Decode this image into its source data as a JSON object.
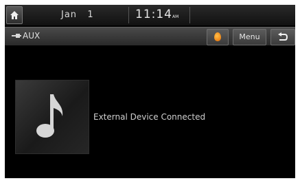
{
  "status_bar": {
    "date": "Jan   1",
    "time": "11:14",
    "ampm": "AM"
  },
  "title_bar": {
    "source": "AUX",
    "menu_label": "Menu"
  },
  "main": {
    "status_text": "External Device Connected"
  },
  "icons": {
    "home": "home-icon",
    "aux": "aux-cable-icon",
    "color_theme": "color-drop-icon",
    "back": "back-arrow-icon",
    "music_note": "music-note-icon"
  },
  "colors": {
    "screen_bg": "#000000",
    "accent_orange": "#f08a00"
  }
}
